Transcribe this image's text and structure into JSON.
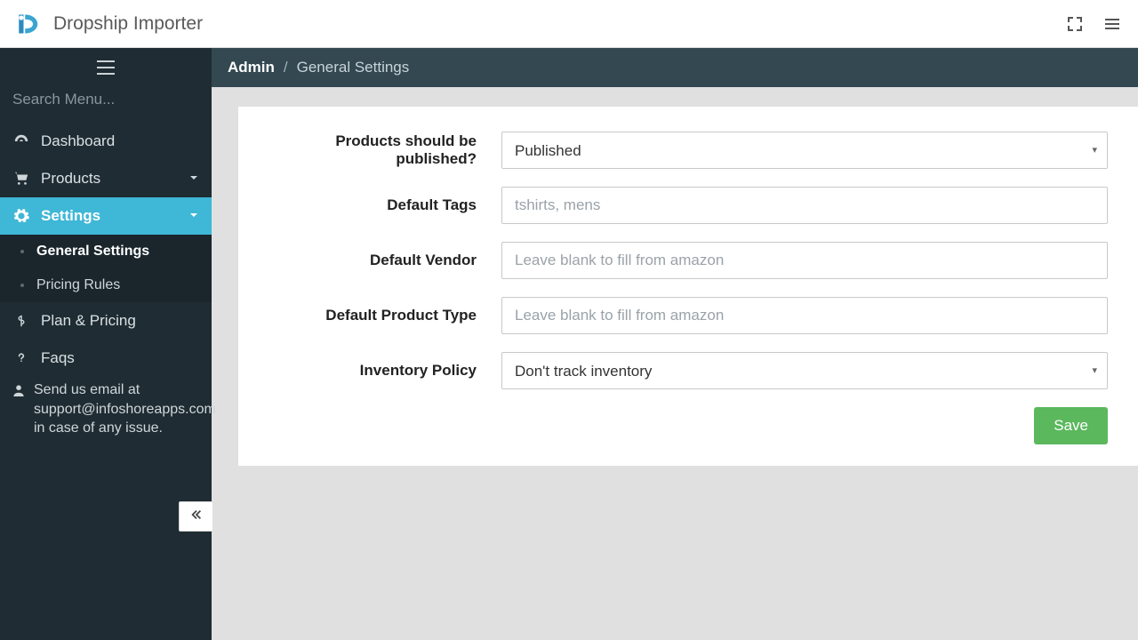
{
  "header": {
    "app_title": "Dropship Importer"
  },
  "sidebar": {
    "search_placeholder": "Search Menu...",
    "items": {
      "dashboard": "Dashboard",
      "products": "Products",
      "settings": "Settings",
      "plan_pricing": "Plan & Pricing",
      "faqs": "Faqs"
    },
    "settings_submenu": {
      "general": "General Settings",
      "pricing_rules": "Pricing Rules"
    },
    "support_text": "Send us email at support@infoshoreapps.com in case of any issue."
  },
  "breadcrumb": {
    "root": "Admin",
    "current": "General Settings"
  },
  "form": {
    "publish": {
      "label": "Products should be published?",
      "value": "Published"
    },
    "tags": {
      "label": "Default Tags",
      "placeholder": "tshirts, mens",
      "value": ""
    },
    "vendor": {
      "label": "Default Vendor",
      "placeholder": "Leave blank to fill from amazon",
      "value": ""
    },
    "product_type": {
      "label": "Default Product Type",
      "placeholder": "Leave blank to fill from amazon",
      "value": ""
    },
    "inventory": {
      "label": "Inventory Policy",
      "value": "Don't track inventory"
    },
    "save_label": "Save"
  }
}
